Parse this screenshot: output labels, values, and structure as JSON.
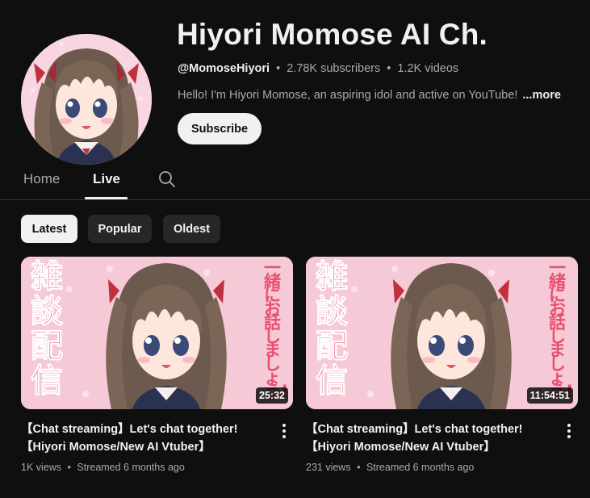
{
  "channel": {
    "title": "Hiyori Momose AI Ch.",
    "handle": "@MomoseHiyori",
    "subscribers": "2.78K subscribers",
    "videos": "1.2K videos",
    "separator": "•",
    "description": "Hello! I'm Hiyori Momose, an aspiring idol and active on YouTube!",
    "more_label": "...more",
    "subscribe_label": "Subscribe"
  },
  "tabs": [
    {
      "label": "Home",
      "selected": false
    },
    {
      "label": "Live",
      "selected": true
    }
  ],
  "chips": [
    {
      "label": "Latest",
      "selected": true
    },
    {
      "label": "Popular",
      "selected": false
    },
    {
      "label": "Oldest",
      "selected": false
    }
  ],
  "videos": [
    {
      "title_line1": "【Chat streaming】Let's chat together!",
      "title_line2": "【Hiyori Momose/New AI Vtuber】",
      "duration": "25:32",
      "views": "1K views",
      "streamed": "Streamed 6 months ago",
      "separator": "•",
      "thumb_text_left": "雑談配信",
      "thumb_text_right": "一緒にお話しましょう!"
    },
    {
      "title_line1": "【Chat streaming】Let's chat together!",
      "title_line2": "【Hiyori Momose/New AI Vtuber】",
      "duration": "11:54:51",
      "views": "231 views",
      "streamed": "Streamed 6 months ago",
      "separator": "•",
      "thumb_text_left": "雑談配信",
      "thumb_text_right": "一緒にお話しましょう!"
    }
  ],
  "colors": {
    "background": "#0f0f0f",
    "text_primary": "#f1f1f1",
    "text_secondary": "#aaaaaa",
    "chip_bg": "#272727",
    "thumb_pink": "#f6c9d6",
    "thumb_text_red": "#e8506e"
  },
  "icons": {
    "search": "search-icon",
    "more_vert": "more-vert-icon"
  }
}
